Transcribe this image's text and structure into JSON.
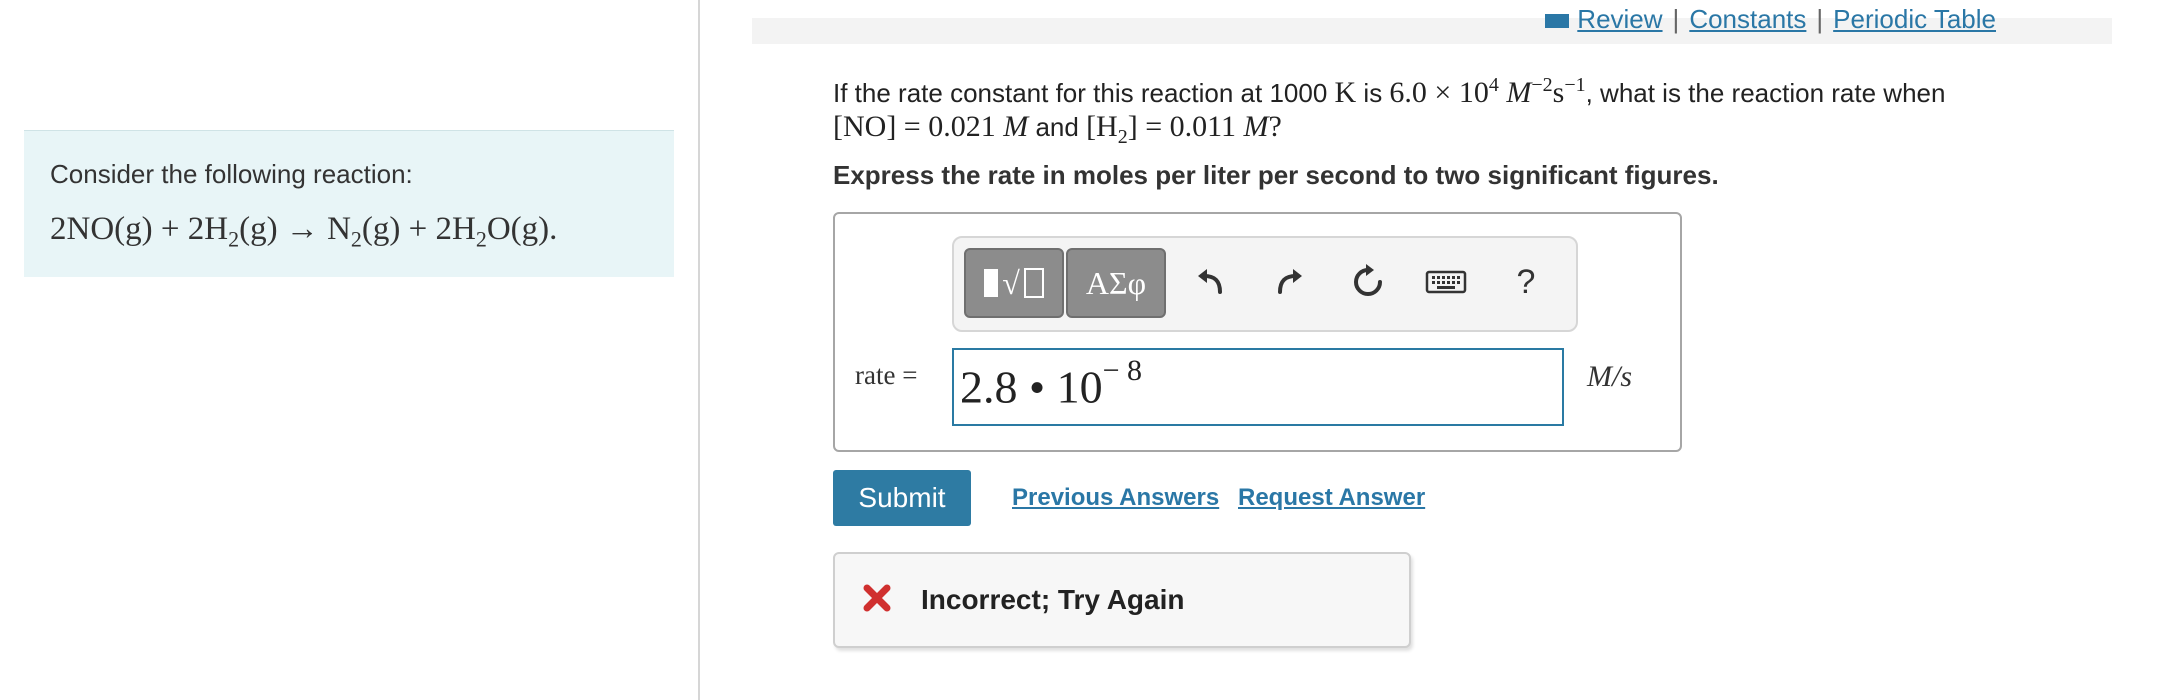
{
  "toplinks": {
    "review": "Review",
    "constants": "Constants",
    "periodic_table": "Periodic Table",
    "separator": "|"
  },
  "intro": {
    "text": "Consider the following reaction:",
    "eq_a": "2NO(g) + 2H",
    "eq_sub1": "2",
    "eq_b": "(g) → N",
    "eq_sub2": "2",
    "eq_c": "(g) + 2H",
    "eq_sub3": "2",
    "eq_d": "O(g)."
  },
  "question": {
    "p1": "If the rate constant for this reaction at 1000 ",
    "K": "K",
    "p2": " is ",
    "k_val": "6.0 × 10",
    "k_exp": "4",
    "M": "M",
    "M_exp": "−2",
    "s": "s",
    "s_exp": "−1",
    "p3": ", what is the reaction rate when",
    "no_expr": "[NO] = 0.021 ",
    "no_M": "M",
    "and": " and ",
    "h2_a": "[H",
    "h2_sub": "2",
    "h2_b": "] = 0.011 ",
    "h2_M": "M",
    "q": "?"
  },
  "instruction": "Express the rate in moles per liter per second to two significant figures.",
  "toolbar": {
    "templates_label": "Templates",
    "greek_label": "ΑΣφ",
    "help_label": "?"
  },
  "answer": {
    "label": "rate =",
    "value": "2.8 • 10",
    "exponent": "− 8",
    "unit": "M/s"
  },
  "actions": {
    "submit": "Submit",
    "previous_answers": "Previous Answers",
    "request_answer": "Request Answer"
  },
  "feedback": {
    "text": "Incorrect; Try Again",
    "icon": "x-mark-icon",
    "icon_color": "#d0302f"
  },
  "colors": {
    "accent": "#2e7ba3",
    "link": "#2a77a6",
    "intro_bg": "#e8f5f7"
  }
}
